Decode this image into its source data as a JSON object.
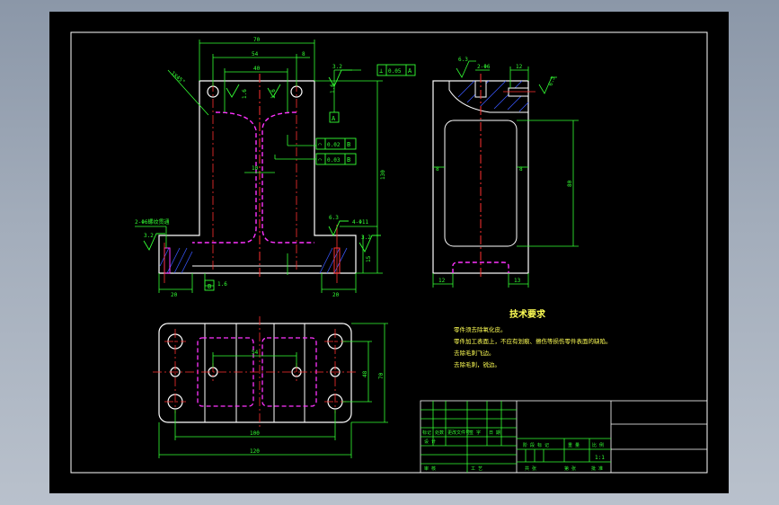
{
  "colors": {
    "outline": "#ffffff",
    "dimension": "#33ff33",
    "centerline": "#ff3030",
    "hidden": "#ff33ff",
    "hatch": "#3a58ff",
    "annotation_text": "#ffff55",
    "background": "#000000"
  },
  "front_view": {
    "dim_total_width": "70",
    "dim_hole_spacing": "54",
    "dim_inner": "40",
    "dim_small": "8",
    "chamfer": "1X45°",
    "roughness_top": "3.2",
    "roughness_foot_left": "3.2",
    "roughness_foot_right": "3.2",
    "roughness_hole": "6.3",
    "dim_rib": "10",
    "dim_height": "130",
    "dim_foot_left": "20",
    "dim_foot_right": "20",
    "dim_foot_height": "15",
    "dim_flat": "1.6",
    "dim_flat2": "1.6",
    "dim_flat3": "1.6",
    "dim_flat4": "1.6",
    "hole_note_left": "2-Φ6螺纹贯通",
    "hole_note_right": "4-Φ11",
    "datum_a": "A",
    "datum_b": "B",
    "tol_perp_sym": "⊥",
    "tol_perp_val": "0.05",
    "tol_perp_ref": "A",
    "tol_flat_sym": "⌒",
    "tol_flat_val": "0.02",
    "tol_flat_ref": "B",
    "tol_para_sym": "⌒",
    "tol_para_val": "0.03",
    "tol_para_ref": "B"
  },
  "side_view": {
    "roughness_top": "6.3",
    "roughness_hole": "6.3",
    "dim_top": "12",
    "dim_8_left": "8",
    "dim_8_right": "8",
    "dim_height": "80",
    "dim_bottom_left": "12",
    "dim_bottom_right": "13",
    "dim_mark": "2-Φ6"
  },
  "top_view": {
    "dim_spacing": "54",
    "dim_hole_pitch": "100",
    "dim_total": "120",
    "dim_width_inner": "48",
    "dim_width": "70"
  },
  "tech_req": {
    "title": "技术要求",
    "items": [
      "零件须去除氧化皮。",
      "零件加工表面上，不应有划痕、擦伤等损伤零件表面的缺陷。",
      "去除毛刺飞边。",
      "去除毛刺，锐边。"
    ]
  },
  "title_block": {
    "cells": [
      "标记",
      "处数",
      "更改文件号",
      "签 字",
      "日 期",
      "设 计",
      "阶 段 标 记",
      "重 量",
      "比 例",
      "审 核",
      "工 艺",
      "共 张",
      "第 张",
      "批 准"
    ],
    "scale": "1:1"
  }
}
